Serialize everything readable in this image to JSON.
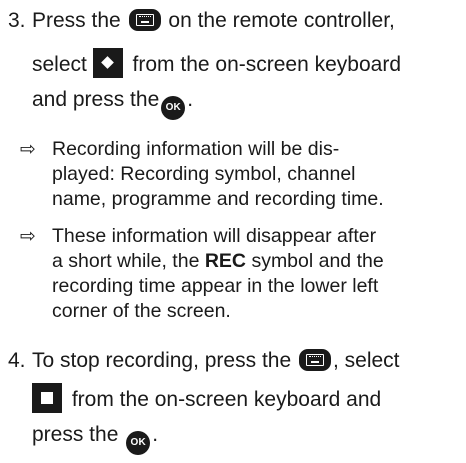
{
  "step3": {
    "number": "3.",
    "t1": "Press the",
    "t2": "on the remote controller,",
    "t3": "select",
    "t4": "from the on-screen keyboard",
    "t5": "and press the",
    "t6": "."
  },
  "notes": [
    {
      "arrow": "⇨",
      "l1": "Recording information will be dis-",
      "l2": "played: Recording symbol, channel",
      "l3": "name, programme and recording time."
    },
    {
      "arrow": "⇨",
      "l1": "These information will disappear after",
      "l2a": "a short while, the",
      "l2b": "REC",
      "l2c": "symbol and the",
      "l3": "recording time appear in the lower left",
      "l4": "corner of the screen."
    }
  ],
  "step4": {
    "number": "4.",
    "t1": "To stop recording, press the",
    "t2": ", select",
    "t3": "from the on-screen keyboard and",
    "t4": "press the",
    "t5": "."
  },
  "icons": {
    "keyboard": "keyboard-icon",
    "ok": "ok-button-icon",
    "ok_label": "OK",
    "record": "record-diamond-icon",
    "stop": "stop-square-icon"
  }
}
